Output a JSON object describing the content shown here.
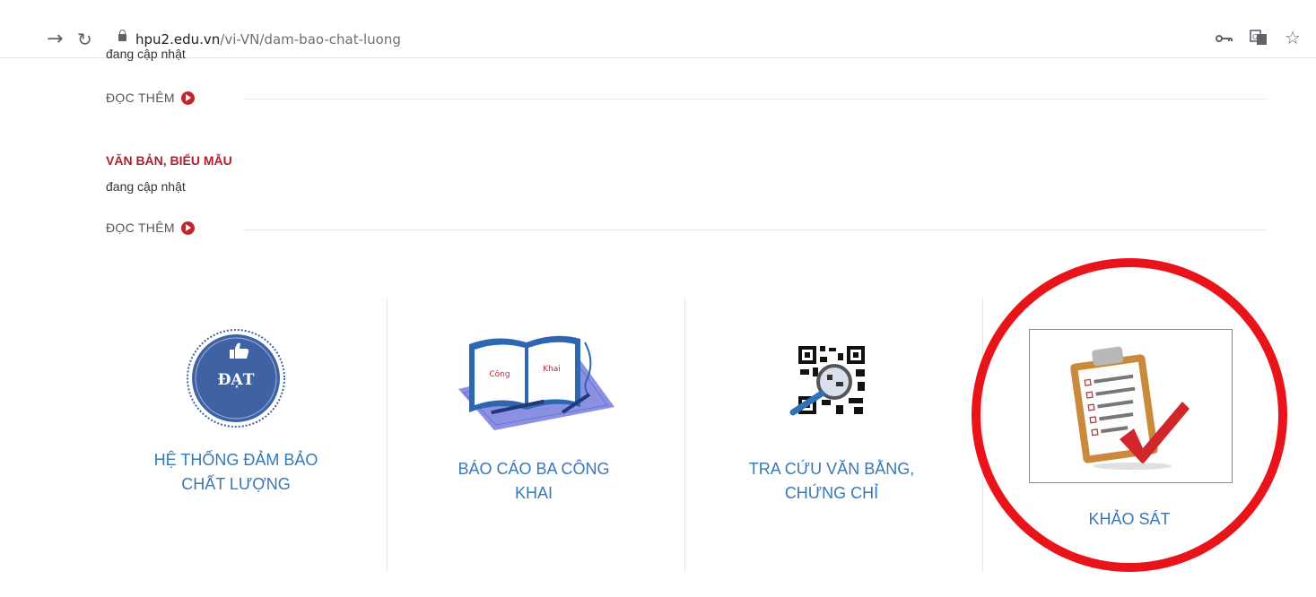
{
  "browser": {
    "url_host": "hpu2.edu.vn",
    "url_path": "/vi-VN/dam-bao-chat-luong"
  },
  "content": {
    "clipped_text": "đang cập nhật",
    "read_more_1": "ĐỌC THÊM",
    "section": {
      "title": "VĂN BẢN, BIỂU MẪU",
      "description": "đang cập nhật",
      "read_more": "ĐỌC THÊM"
    }
  },
  "cards": [
    {
      "line1": "HỆ THỐNG ĐẢM BẢO",
      "line2": "CHẤT LƯỢNG",
      "badge_text": "ĐẠT",
      "icon": "quality-badge-icon"
    },
    {
      "line1": "BÁO CÁO BA CÔNG",
      "line2": "KHAI",
      "book_left": "Công",
      "book_right": "Khai",
      "icon": "open-book-icon"
    },
    {
      "line1": "TRA CỨU VĂN BẰNG,",
      "line2": "CHỨNG CHỈ",
      "icon": "qr-magnifier-icon"
    },
    {
      "line1": "KHẢO SÁT",
      "icon": "survey-clipboard-icon"
    }
  ],
  "colors": {
    "link_blue": "#3a77b5",
    "title_red": "#b11f2c",
    "annotation_red": "#e8141a",
    "badge_blue": "#3f62a5"
  },
  "icons": {
    "forward": "forward-arrow-icon",
    "reload": "reload-icon",
    "lock": "lock-icon",
    "key": "key-icon",
    "translate": "translate-icon",
    "star": "star-icon"
  }
}
